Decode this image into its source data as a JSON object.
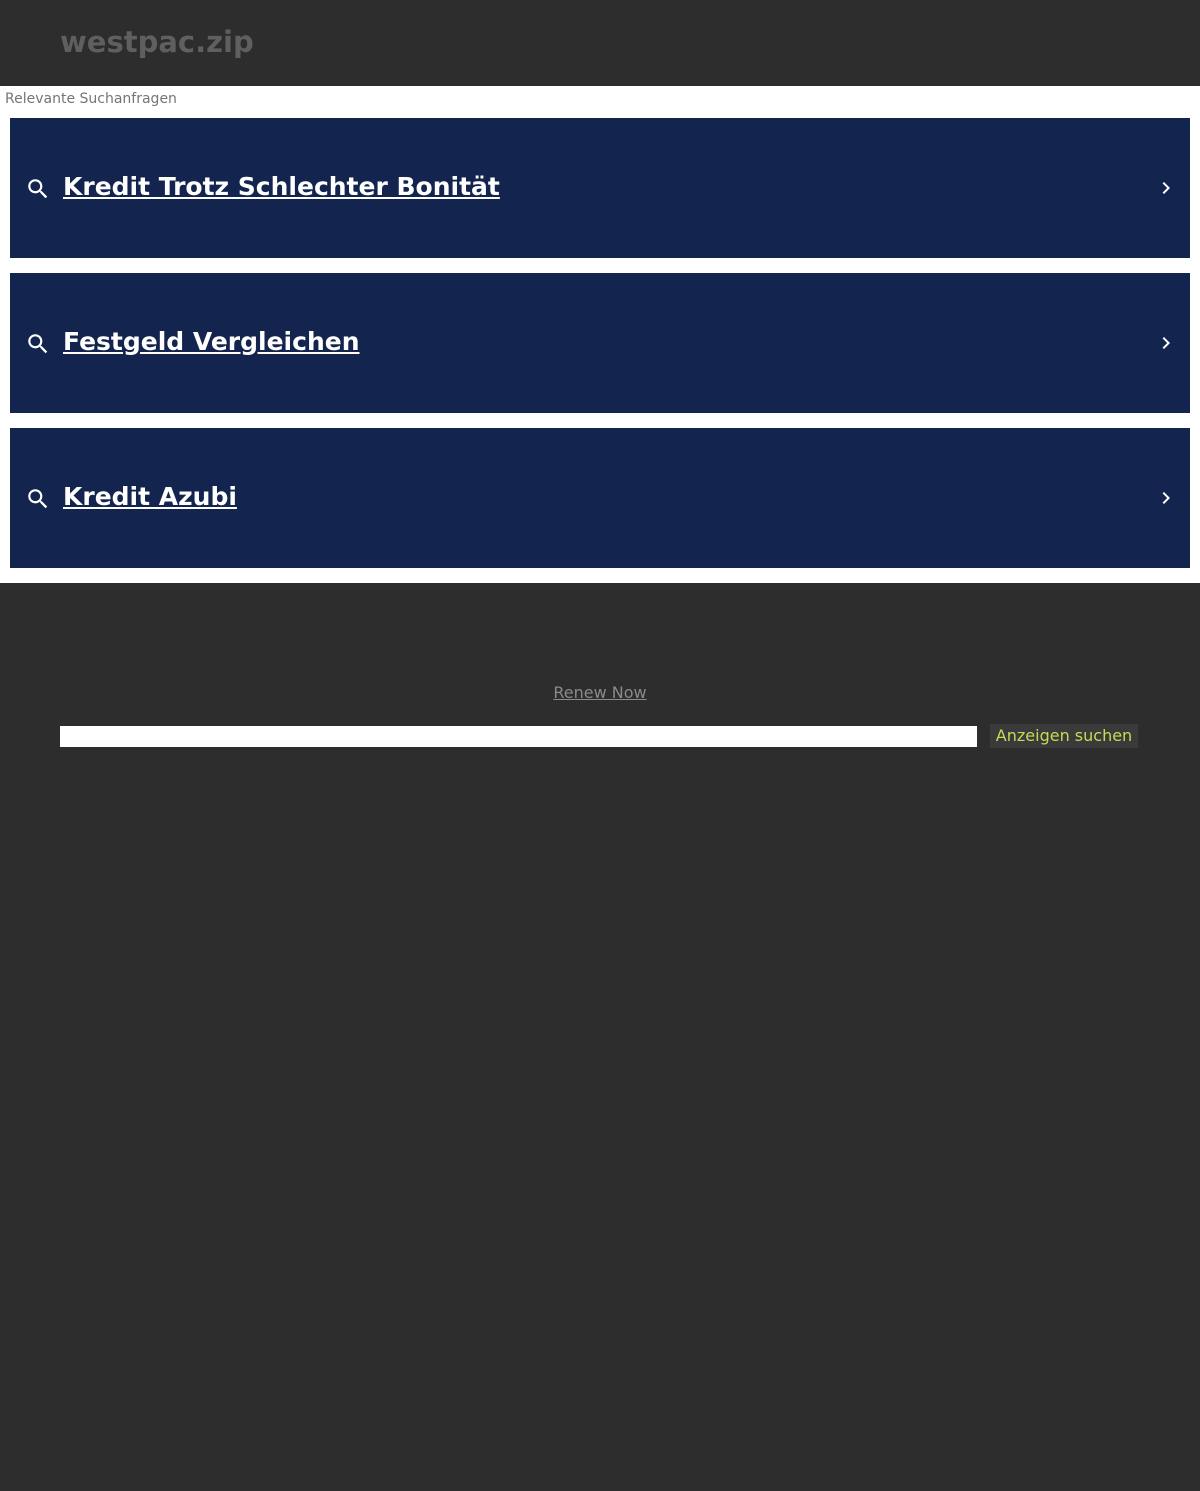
{
  "header": {
    "domain": "westpac.zip"
  },
  "related": {
    "heading": "Relevante Suchanfragen",
    "items": [
      {
        "label": "Kredit Trotz Schlechter Bonität",
        "icon": "search-icon",
        "arrow": "chevron-right-icon"
      },
      {
        "label": "Festgeld Vergleichen",
        "icon": "search-icon",
        "arrow": "chevron-right-icon"
      },
      {
        "label": "Kredit Azubi",
        "icon": "search-icon",
        "arrow": "chevron-right-icon"
      }
    ]
  },
  "footer": {
    "renew_label": "Renew Now",
    "search_value": "",
    "search_button_label": "Anzeigen suchen"
  },
  "colors": {
    "background": "#2d2d2d",
    "result_background": "#13244e",
    "button_text": "#c4dc55"
  }
}
